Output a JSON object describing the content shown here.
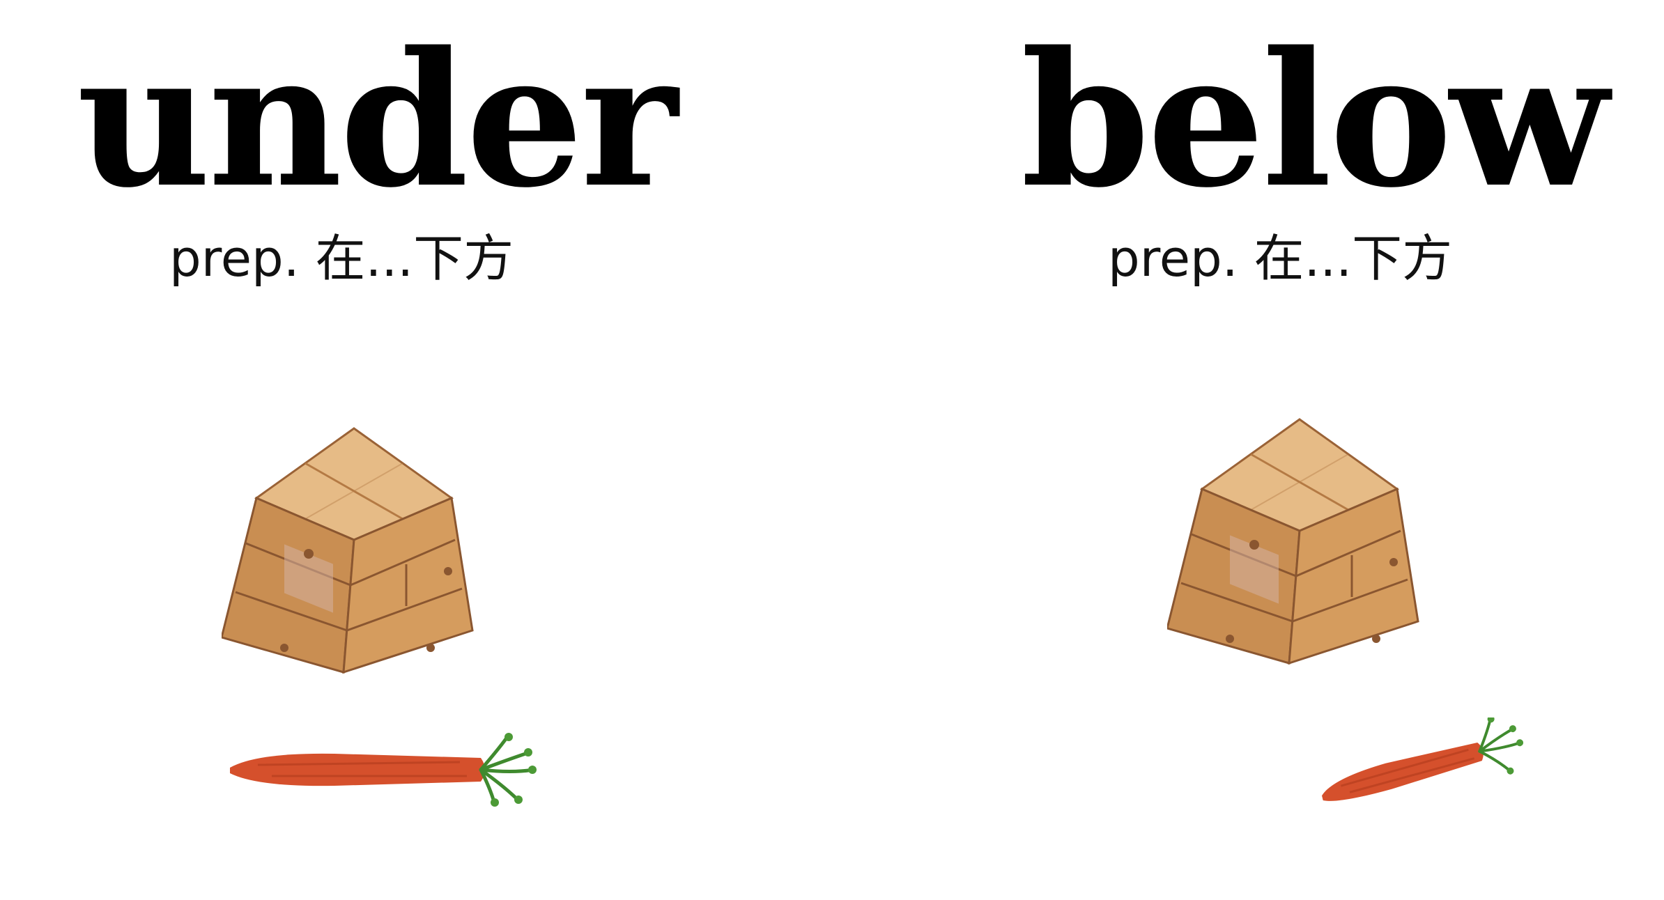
{
  "cards": [
    {
      "word": "under",
      "gloss": "prep. 在...下方",
      "illustration": {
        "top_object": "wooden-block-cube",
        "bottom_object": "carrot",
        "relation": "carrot lies directly beneath the block"
      }
    },
    {
      "word": "below",
      "gloss": "prep. 在...下方",
      "illustration": {
        "top_object": "wooden-block-cube",
        "bottom_object": "carrot",
        "relation": "carrot lies lower than the block, offset to the side"
      }
    }
  ],
  "colors": {
    "background": "#ffffff",
    "text": "#000000",
    "wood_light": "#e2b47e",
    "wood_mid": "#c98e52",
    "wood_dark": "#9a6236",
    "carrot": "#d5502c",
    "carrot_leaf": "#3f8a2e"
  }
}
